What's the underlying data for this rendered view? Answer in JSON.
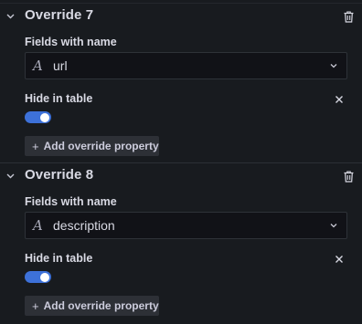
{
  "overrides": [
    {
      "title": "Override 7",
      "matcher_label": "Fields with name",
      "matcher_value": "url",
      "property_label": "Hide in table",
      "property_enabled": true,
      "add_label": "Add override property"
    },
    {
      "title": "Override 8",
      "matcher_label": "Fields with name",
      "matcher_value": "description",
      "property_label": "Hide in table",
      "property_enabled": true,
      "add_label": "Add override property"
    }
  ],
  "icons": {
    "collapse": "chevron-down-icon",
    "delete": "trash-icon",
    "field_type": "text-type-icon",
    "dropdown": "chevron-down-icon",
    "remove_property": "close-icon",
    "add": "plus-icon"
  },
  "colors": {
    "background": "#181b1f",
    "toggle_on": "#3d71d9",
    "button_bg": "#2d3036",
    "input_bg": "#111217"
  }
}
